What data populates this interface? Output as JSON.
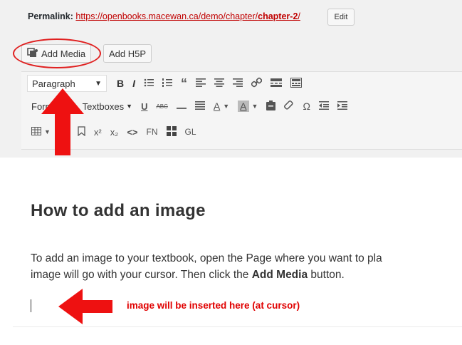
{
  "permalink": {
    "label": "Permalink:",
    "url_prefix": "https://openbooks.macewan.ca/demo/chapter/",
    "url_slug": "chapter-2",
    "url_suffix": "/",
    "edit_label": "Edit"
  },
  "media_buttons": {
    "add_media": "Add Media",
    "add_h5p": "Add H5P"
  },
  "toolbar": {
    "row1": {
      "format_select": "Paragraph",
      "bold": "B",
      "italic": "I",
      "blockquote": "“",
      "icons": [
        "bold-icon",
        "italic-icon",
        "bullet-list-icon",
        "numbered-list-icon",
        "blockquote-icon",
        "align-left-icon",
        "align-center-icon",
        "align-right-icon",
        "link-icon",
        "read-more-icon",
        "toolbar-toggle-icon"
      ]
    },
    "row2": {
      "formats_select": "Formats",
      "textboxes_select": "Textboxes",
      "underline": "U",
      "strike": "ABC",
      "font_color": "A",
      "background_color": "A",
      "omega": "Ω"
    },
    "row3": {
      "superscript": "x²",
      "subscript": "x₂",
      "code": "<>",
      "footnote": "FN",
      "glossary": "GL"
    }
  },
  "content": {
    "heading": "How to add an image",
    "paragraph_line1": "To add an image to your textbook, open the Page where you want to pla",
    "paragraph_line2_prefix": "image will go with your cursor. Then click the ",
    "paragraph_line2_bold": "Add Media",
    "paragraph_line2_suffix": " button."
  },
  "annotations": {
    "note": "image will be inserted here (at cursor)",
    "color": "#e00000"
  }
}
